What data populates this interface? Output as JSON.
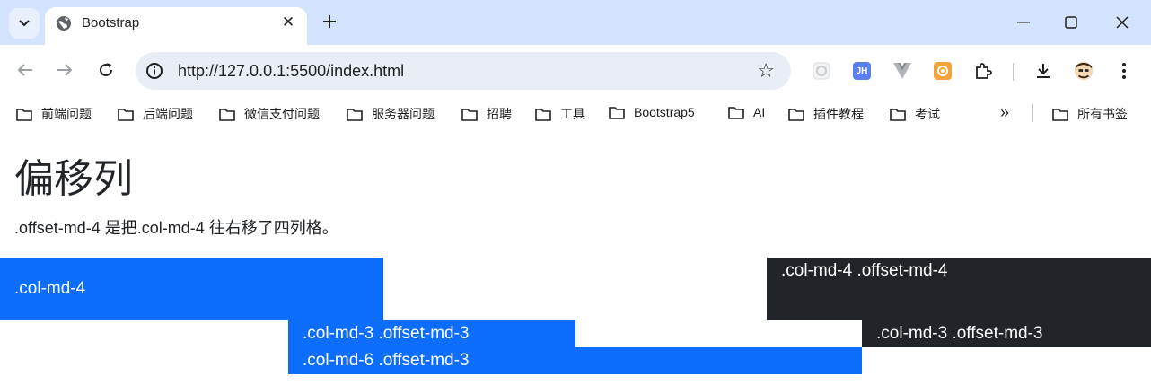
{
  "browser": {
    "tab_title": "Bootstrap",
    "url": "http://127.0.0.1:5500/index.html",
    "bookmarks": [
      "前端问题",
      "后端问题",
      "微信支付问题",
      "服务器问题",
      "招聘",
      "工具",
      "Bootstrap5",
      "AI",
      "插件教程",
      "考试"
    ],
    "all_bookmarks": "所有书签",
    "ext_jh": "JH"
  },
  "page": {
    "title": "偏移列",
    "description": ".offset-md-4 是把.col-md-4 往右移了四列格。",
    "rows": [
      {
        "col1": ".col-md-4",
        "col2": ".col-md-4 .offset-md-4"
      },
      {
        "col1": ".col-md-3 .offset-md-3",
        "col2": ".col-md-3 .offset-md-3"
      },
      {
        "col1": ".col-md-6 .offset-md-3"
      }
    ]
  },
  "colors": {
    "primary": "#0d6efd",
    "dark": "#212529",
    "tabbar": "#d3e3fd"
  }
}
